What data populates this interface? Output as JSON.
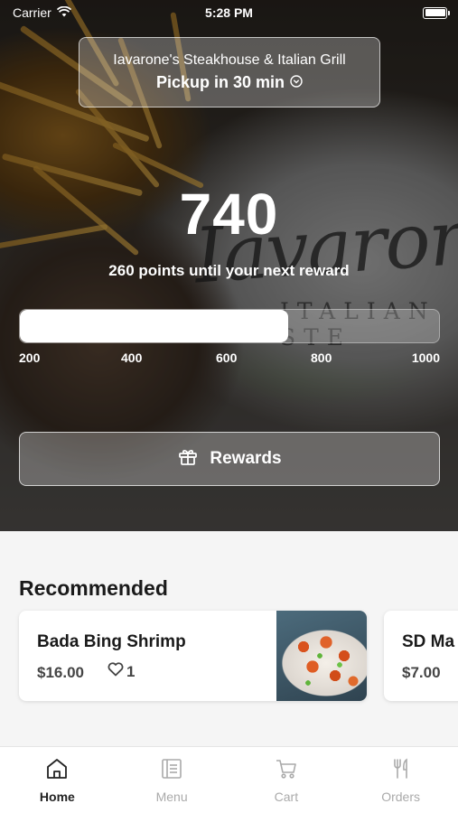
{
  "status_bar": {
    "carrier": "Carrier",
    "time": "5:28 PM"
  },
  "store": {
    "name": "Iavarone's Steakhouse & Italian Grill",
    "pickup": "Pickup in 30 min"
  },
  "hero_logo": {
    "script": "Iavarone",
    "subtitle": "ITALIAN STE"
  },
  "rewards": {
    "points": "740",
    "subtitle": "260 points until your next reward",
    "progress_fraction": 0.64,
    "ticks": [
      "200",
      "400",
      "600",
      "800",
      "1000"
    ],
    "button_label": "Rewards"
  },
  "recommended": {
    "title": "Recommended",
    "items": [
      {
        "name": "Bada Bing Shrimp",
        "price": "$16.00",
        "likes": "1"
      },
      {
        "name": "SD Ma",
        "price": "$7.00"
      }
    ]
  },
  "tabs": [
    {
      "label": "Home",
      "icon": "home-icon",
      "active": true
    },
    {
      "label": "Menu",
      "icon": "menu-icon",
      "active": false
    },
    {
      "label": "Cart",
      "icon": "cart-icon",
      "active": false
    },
    {
      "label": "Orders",
      "icon": "utensils-icon",
      "active": false
    }
  ],
  "colors": {
    "tab_active": "#222222",
    "tab_inactive": "#aaaaaa",
    "content_bg": "#f5f5f5"
  }
}
